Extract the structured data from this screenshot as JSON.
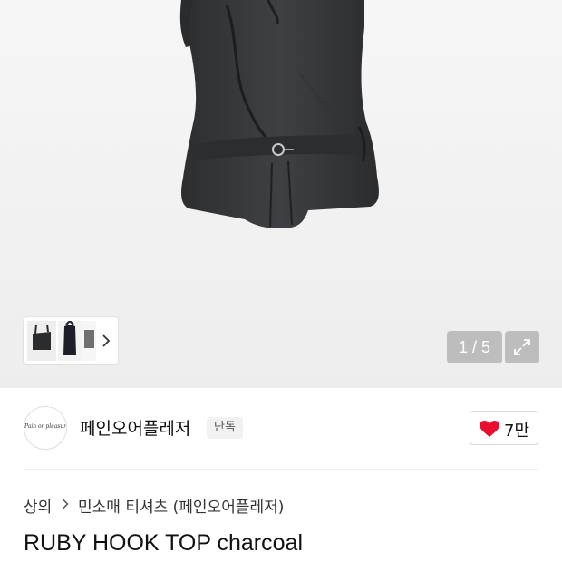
{
  "gallery": {
    "counter": "1 / 5",
    "main_image": "charcoal-halter-top-photo",
    "thumbnails": [
      "charcoal-top-thumb",
      "black-halter-top-thumb",
      "grey-top-thumb"
    ]
  },
  "brand": {
    "logo_text": "Pain or pleasure",
    "name": "페인오어플레저",
    "badge": "단독"
  },
  "like": {
    "count": "7만",
    "icon": "heart-icon",
    "color": "#e8102e"
  },
  "breadcrumb": {
    "items": [
      "상의",
      "민소매 티셔츠 (페인오어플레저)"
    ]
  },
  "product": {
    "title": "RUBY HOOK TOP charcoal"
  }
}
